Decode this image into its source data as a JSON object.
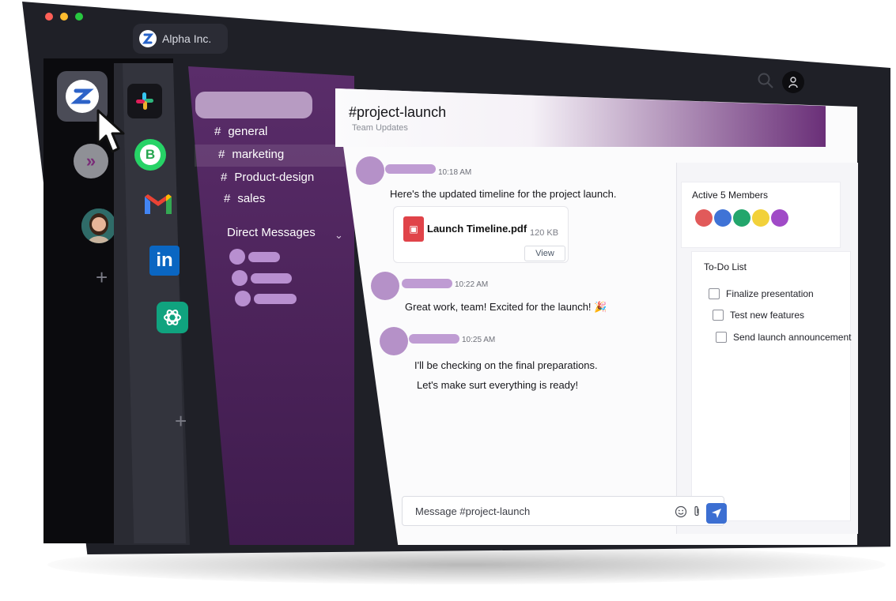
{
  "window": {
    "workspace_name": "Alpha Inc."
  },
  "colors": {
    "traffic": [
      "#ff5f57",
      "#febc2e",
      "#28c840"
    ],
    "purple_panel": "#4a2258",
    "member_dots": [
      "#e15a5a",
      "#3f73d6",
      "#23a66c",
      "#f2d13a",
      "#a04ac7"
    ]
  },
  "channels": [
    {
      "hash": "#",
      "name": "general"
    },
    {
      "hash": "#",
      "name": "marketing"
    },
    {
      "hash": "#",
      "name": "Product-design"
    },
    {
      "hash": "#",
      "name": "sales"
    }
  ],
  "direct_messages_label": "Direct Messages",
  "chat": {
    "title": "#project-launch",
    "subtitle": "Team Updates",
    "messages": [
      {
        "time": "10:18 AM",
        "text": "Here's the updated timeline for the project launch."
      },
      {
        "time": "10:22 AM",
        "text": "Great work, team! Excited for the launch! 🎉"
      },
      {
        "time": "10:25 AM",
        "line1": "I'll be checking on the final preparations.",
        "line2": "Let's make surt everything is ready!"
      }
    ],
    "attachment": {
      "name": "Launch Timeline.pdf",
      "size": "120 KB",
      "action": "View"
    },
    "composer_placeholder": "Message #project-launch"
  },
  "members": {
    "title": "Active 5 Members"
  },
  "todo": {
    "title": "To-Do List",
    "items": [
      "Finalize presentation",
      "Test new features",
      "Send launch announcement"
    ]
  },
  "icons": {
    "search": "search-icon",
    "profile": "user-icon",
    "add": "plus-icon",
    "emoji": "emoji-icon",
    "attach": "paperclip-icon",
    "send": "send-icon"
  }
}
